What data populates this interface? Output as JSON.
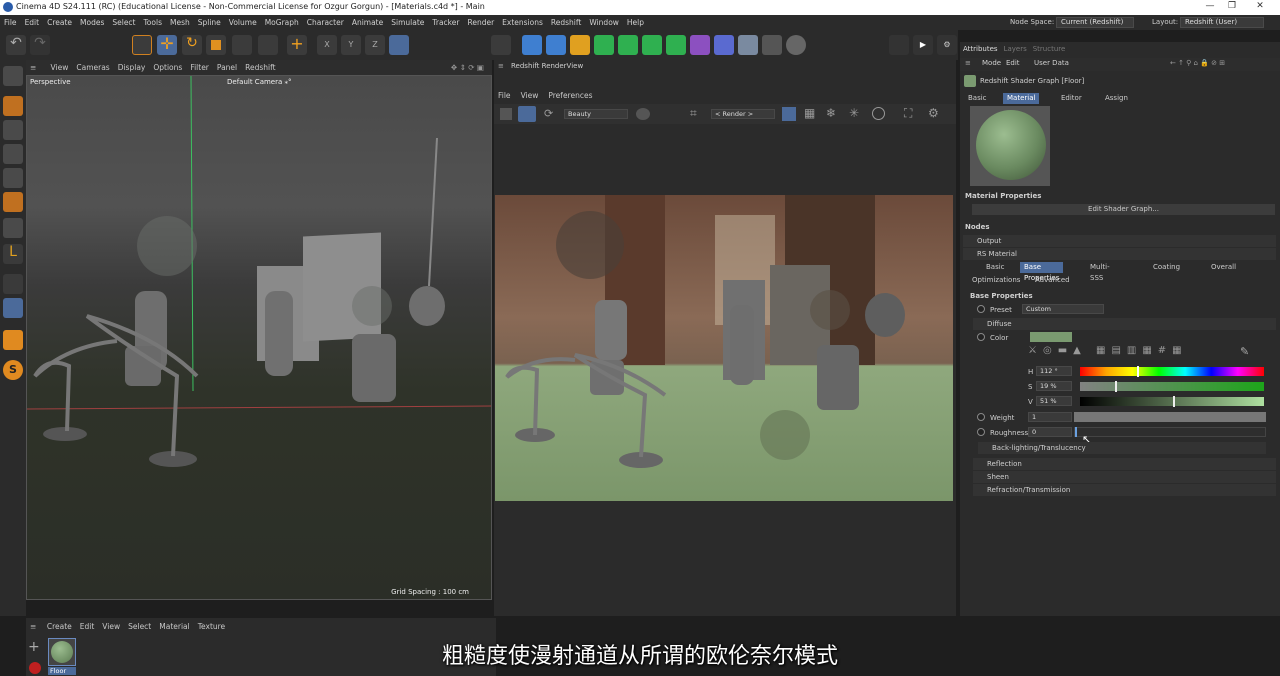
{
  "titlebar": {
    "title": "Cinema 4D S24.111 (RC) (Educational License - Non-Commercial License for Ozgur Gorgun) - [Materials.c4d *] - Main",
    "min": "—",
    "max": "❐",
    "close": "✕"
  },
  "menubar": {
    "items": [
      "File",
      "Edit",
      "Create",
      "Modes",
      "Select",
      "Tools",
      "Mesh",
      "Spline",
      "Volume",
      "MoGraph",
      "Character",
      "Animate",
      "Simulate",
      "Tracker",
      "Render",
      "Extensions",
      "Redshift",
      "Window",
      "Help"
    ],
    "node_space_label": "Node Space:",
    "node_space_value": "Current (Redshift)",
    "layout_label": "Layout:",
    "layout_value": "Redshift (User)"
  },
  "viewport": {
    "menu": [
      "View",
      "Cameras",
      "Display",
      "Options",
      "Filter",
      "Panel",
      "Redshift"
    ],
    "name": "Perspective",
    "camera": "Default Camera ⁎°",
    "grid_spacing": "Grid Spacing : 100 cm"
  },
  "renderview": {
    "title": "Redshift RenderView",
    "menu": [
      "File",
      "View",
      "Preferences"
    ],
    "aov": "Beauty",
    "render_sel": "< Render >"
  },
  "attributes": {
    "tabs": [
      "Attributes",
      "Layers",
      "Structure"
    ],
    "menu": [
      "Mode",
      "Edit",
      "User Data"
    ],
    "object_title": "Redshift Shader Graph [Floor]",
    "subtabs": [
      "Basic",
      "Material",
      "Editor",
      "Assign"
    ],
    "active_subtab": "Material",
    "material_properties": "Material Properties",
    "edit_shader_graph": "Edit Shader Graph...",
    "nodes": "Nodes",
    "output": "Output",
    "rs_material": "RS Material",
    "rs_tabs": [
      "Basic",
      "Base Properties",
      "Multi-SSS",
      "Coating",
      "Overall"
    ],
    "rs_tabs2": [
      "Optimizations",
      "Advanced"
    ],
    "active_rs_tab": "Base Properties",
    "base_properties": "Base Properties",
    "preset_label": "Preset",
    "preset_value": "Custom",
    "diffuse": "Diffuse",
    "color_label": "Color",
    "color_hex": "#7a9a70",
    "h_label": "H",
    "h_value": "112 °",
    "s_label": "S",
    "s_value": "19 %",
    "v_label": "V",
    "v_value": "51 %",
    "weight_label": "Weight",
    "weight_value": "1",
    "roughness_label": "Roughness",
    "roughness_value": "0",
    "backlighting": "Back-lighting/Translucency",
    "reflection": "Reflection",
    "sheen": "Sheen",
    "refraction": "Refraction/Transmission"
  },
  "material_manager": {
    "menu": [
      "Create",
      "Edit",
      "View",
      "Select",
      "Material",
      "Texture"
    ],
    "material_name": "Floor"
  },
  "subtitle": "粗糙度使漫射通道从所谓的欧伦奈尔模式"
}
